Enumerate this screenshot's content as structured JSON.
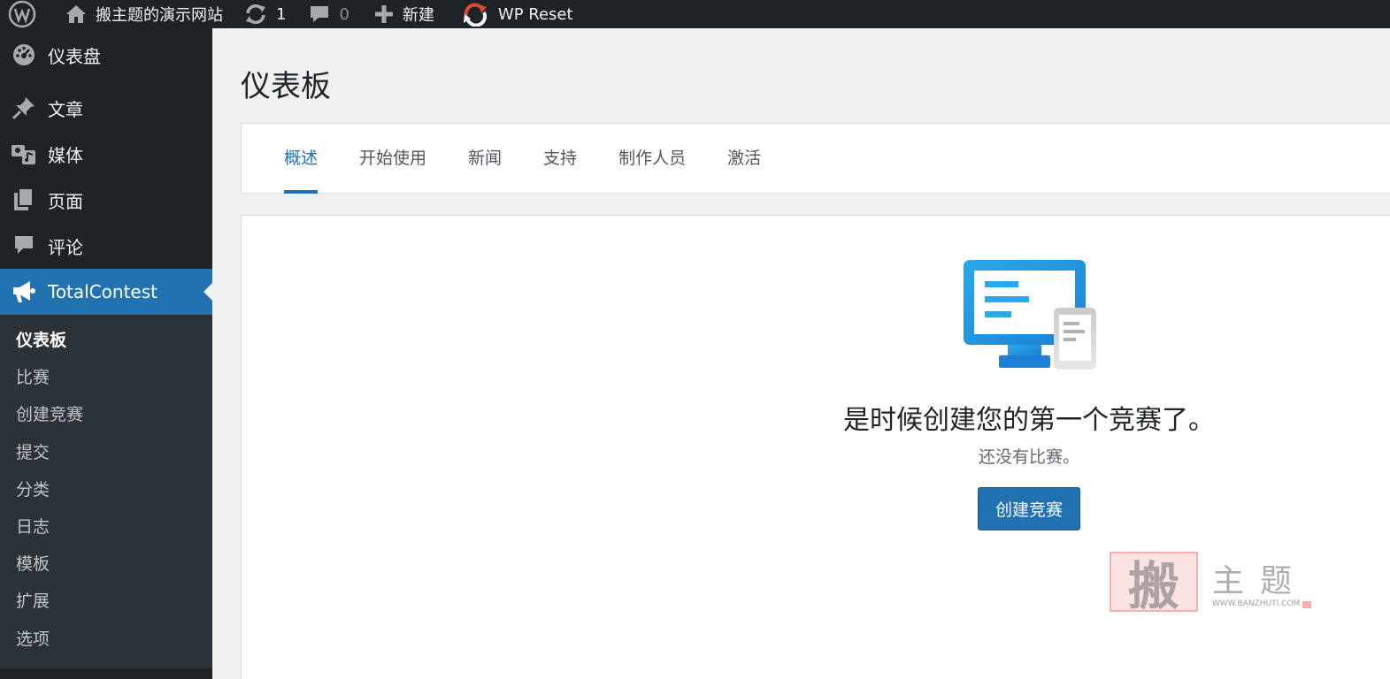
{
  "admin_bar": {
    "site_name": "搬主题的演示网站",
    "updates_count": "1",
    "comments_count": "0",
    "new_label": "新建",
    "reset_label": "WP Reset"
  },
  "sidebar": {
    "dashboard": "仪表盘",
    "posts": "文章",
    "media": "媒体",
    "pages": "页面",
    "comments": "评论",
    "plugin": "TotalContest",
    "submenu": [
      "仪表板",
      "比赛",
      "创建竞赛",
      "提交",
      "分类",
      "日志",
      "模板",
      "扩展",
      "选项"
    ]
  },
  "main": {
    "title": "仪表板",
    "tabs": [
      "概述",
      "开始使用",
      "新闻",
      "支持",
      "制作人员",
      "激活"
    ],
    "empty_state": {
      "title": "是时候创建您的第一个竞赛了。",
      "subtitle": "还没有比赛。",
      "button": "创建竞赛"
    }
  },
  "watermark": {
    "seal": "搬",
    "text": "主题",
    "url": "WWW.BANZHUTI.COM"
  },
  "colors": {
    "admin_bg": "#1d2327",
    "submenu_bg": "#2c3338",
    "accent": "#2271b1",
    "page_bg": "#f0f0f1"
  }
}
